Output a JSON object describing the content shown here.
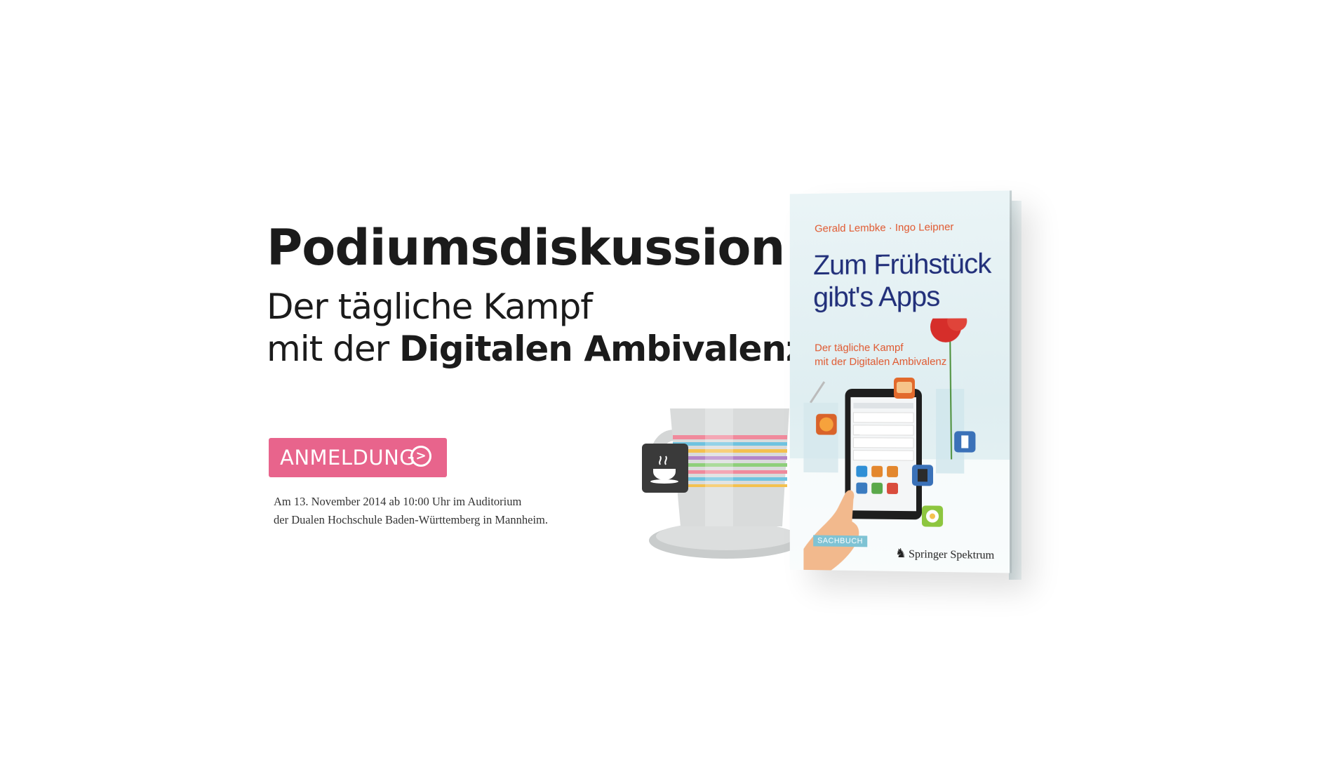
{
  "headline": "Podiumsdiskussion",
  "subline": {
    "line1": "Der tägliche Kampf",
    "line2_prefix": "mit der ",
    "line2_bold": "Digitalen Ambivalenz"
  },
  "cta": {
    "label": "ANMELDUNG",
    "icon": "circle-arrow-right-icon",
    "color": "#e8648c"
  },
  "event": {
    "line1": "Am 13. November 2014 ab 10:00 Uhr im Auditorium",
    "line2": "der Dualen Hochschule Baden-Württemberg in Mannheim."
  },
  "book": {
    "authors": "Gerald Lembke · Ingo Leipner",
    "title_line1": "Zum Frühstück",
    "title_line2": "gibt's Apps",
    "subtitle_line1": "Der tägliche Kampf",
    "subtitle_line2": "mit der Digitalen Ambivalenz",
    "badge": "SACHBUCH",
    "publisher_name": "Springer",
    "publisher_suffix": "Spektrum"
  },
  "colors": {
    "accent": "#e8648c",
    "book_title": "#22307a",
    "book_subtitle": "#e0582f"
  }
}
